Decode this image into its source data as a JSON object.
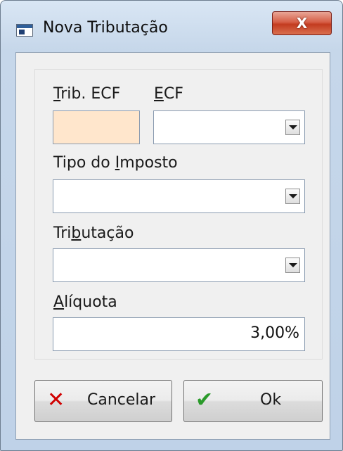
{
  "window": {
    "title": "Nova Tributação",
    "close_glyph": "X"
  },
  "form": {
    "trib_ecf": {
      "label_mnemonic": "T",
      "label_rest": "rib. ECF",
      "value": "",
      "bg_color": "#ffe6cc"
    },
    "ecf": {
      "label_mnemonic": "E",
      "label_rest": "CF",
      "value": ""
    },
    "tipo_imposto": {
      "label_pre": "Tipo do ",
      "label_mnemonic": "I",
      "label_rest": "mposto",
      "value": ""
    },
    "tributacao": {
      "label_pre": "Tri",
      "label_mnemonic": "b",
      "label_rest": "utação",
      "value": ""
    },
    "aliquota": {
      "label_mnemonic": "A",
      "label_rest": "líquota",
      "value": "3,00%"
    }
  },
  "buttons": {
    "cancel": {
      "label": "Cancelar",
      "icon": "x-mark-icon",
      "icon_glyph": "✕",
      "icon_color": "#d00000"
    },
    "ok": {
      "label": "Ok",
      "icon": "check-icon",
      "icon_glyph": "✔",
      "icon_color": "#2a9a2a"
    }
  }
}
